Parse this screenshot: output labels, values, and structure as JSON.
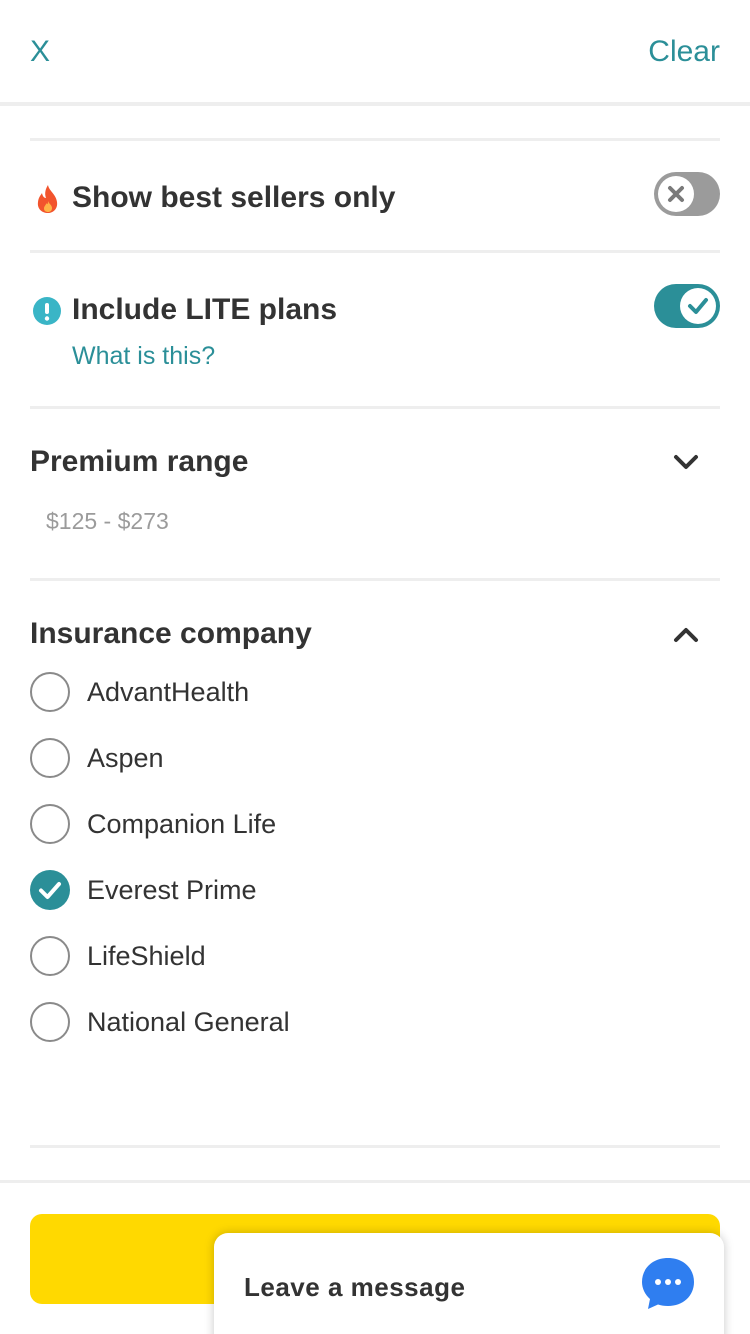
{
  "header": {
    "close_label": "X",
    "clear_label": "Clear"
  },
  "best_sellers": {
    "icon": "flame-icon",
    "label": "Show best sellers only",
    "toggle_on": false
  },
  "lite_plans": {
    "icon": "info-icon",
    "label": "Include LITE plans",
    "link": "What is this?",
    "toggle_on": true
  },
  "premium_range": {
    "title": "Premium range",
    "value": "$125 - $273",
    "expanded": false
  },
  "insurance_company": {
    "title": "Insurance company",
    "expanded": true,
    "options": [
      {
        "label": "AdvantHealth",
        "checked": false
      },
      {
        "label": "Aspen",
        "checked": false
      },
      {
        "label": "Companion Life",
        "checked": false
      },
      {
        "label": "Everest Prime",
        "checked": true
      },
      {
        "label": "LifeShield",
        "checked": false
      },
      {
        "label": "National General",
        "checked": false
      }
    ]
  },
  "chat": {
    "label": "Leave a message",
    "icon": "chat-bubble-icon"
  },
  "colors": {
    "accent": "#2b8f98",
    "cta": "#ffd900",
    "flame": "#f2542d",
    "info": "#3ab5c6",
    "chat": "#2f7ef0"
  }
}
